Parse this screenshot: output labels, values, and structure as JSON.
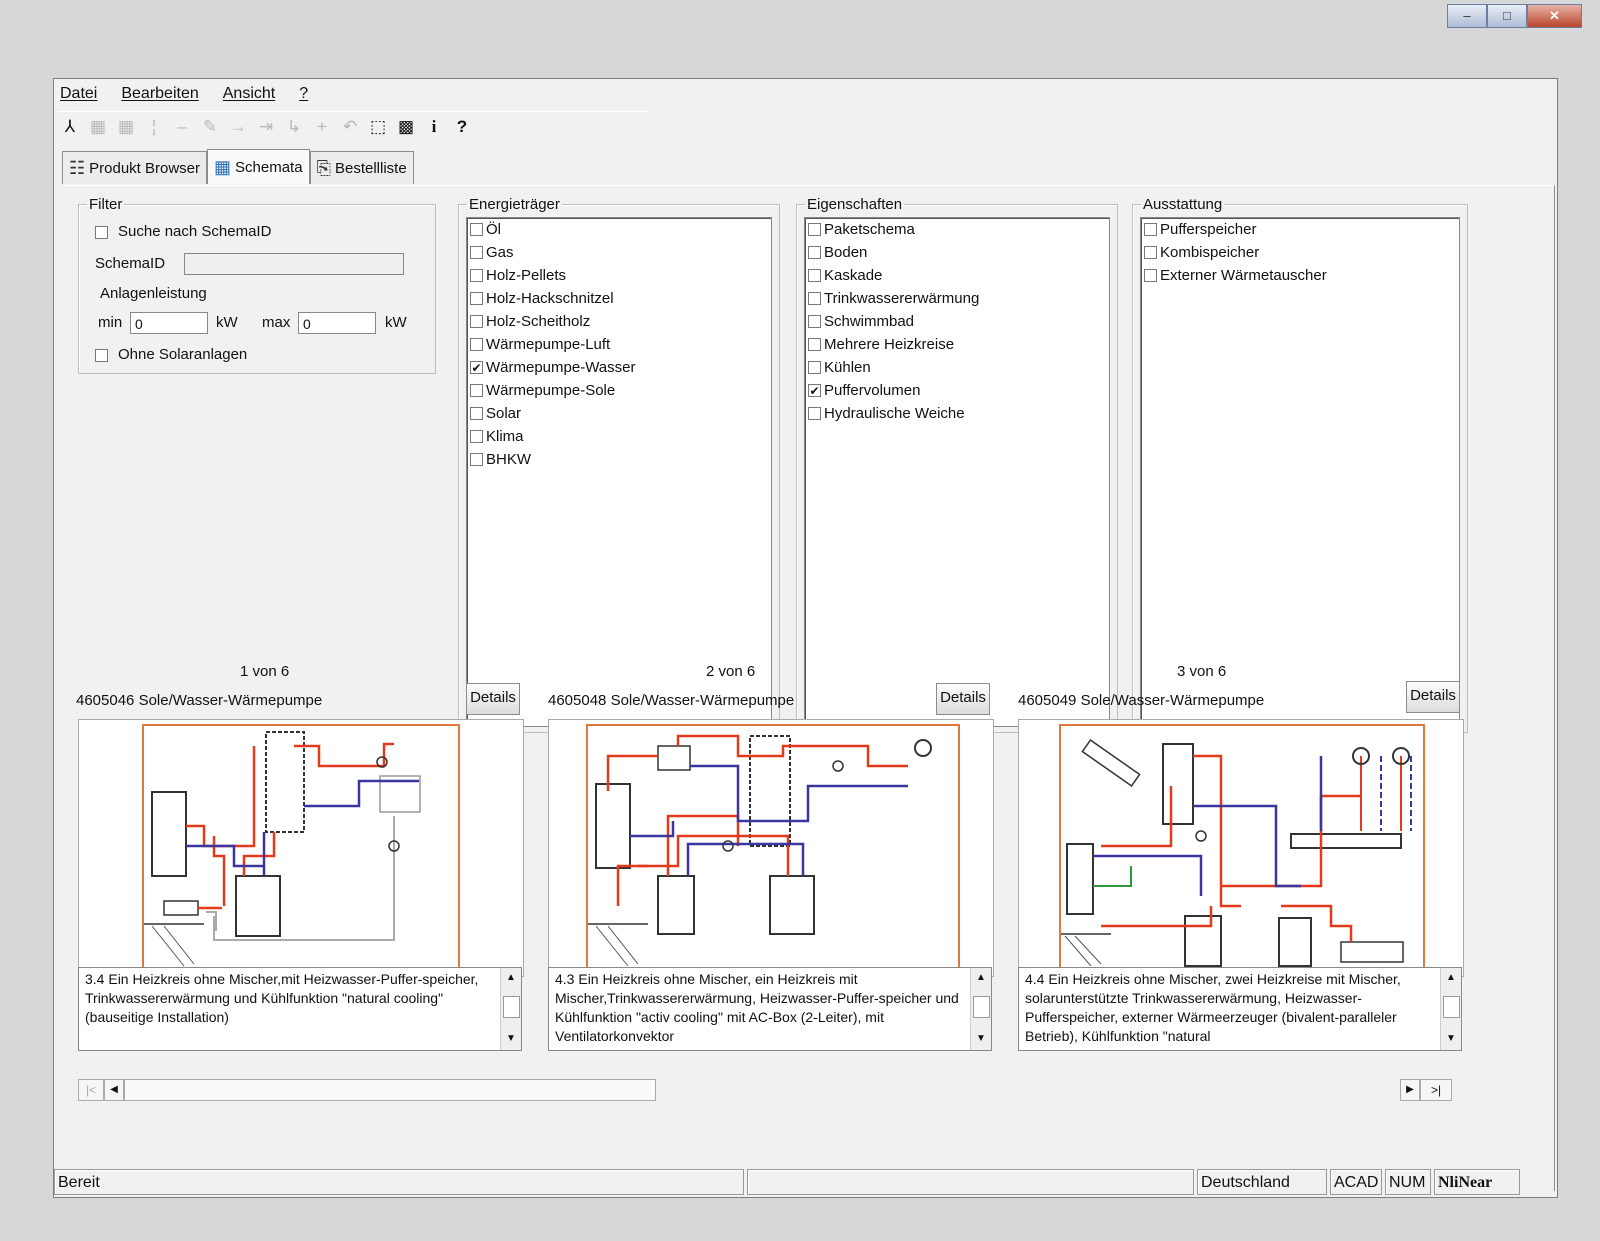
{
  "window_controls": {
    "minimize": "–",
    "maximize": "□",
    "close": "✕"
  },
  "menu": [
    "Datei",
    "Bearbeiten",
    "Ansicht",
    "?"
  ],
  "toolbar_icons": [
    "fork-icon",
    "edit-icon",
    "edit-icon",
    "separator-icon",
    "line-icon",
    "pencil-icon",
    "arrow-icon",
    "arrow-icon",
    "arrow-icon",
    "plus-icon",
    "undo-icon",
    "pointer-icon",
    "grid-icon",
    "info-icon",
    "help-icon"
  ],
  "tabs": [
    {
      "label": "Produkt Browser",
      "icon": "tree-icon"
    },
    {
      "label": "Schemata",
      "icon": "schema-icon"
    },
    {
      "label": "Bestellliste",
      "icon": "order-icon"
    }
  ],
  "filter": {
    "legend": "Filter",
    "search_label": "Suche nach SchemaID",
    "schema_id_label": "SchemaID",
    "schema_id_value": "",
    "power_label": "Anlagenleistung",
    "min_label": "min",
    "min_value": "0",
    "max_label": "max",
    "max_value": "0",
    "unit": "kW",
    "solar_label": "Ohne Solaranlagen"
  },
  "energietraeger": {
    "legend": "Energieträger",
    "items": [
      {
        "label": "Öl",
        "checked": false
      },
      {
        "label": "Gas",
        "checked": false
      },
      {
        "label": "Holz-Pellets",
        "checked": false
      },
      {
        "label": "Holz-Hackschnitzel",
        "checked": false
      },
      {
        "label": "Holz-Scheitholz",
        "checked": false
      },
      {
        "label": "Wärmepumpe-Luft",
        "checked": false
      },
      {
        "label": "Wärmepumpe-Wasser",
        "checked": true
      },
      {
        "label": "Wärmepumpe-Sole",
        "checked": false
      },
      {
        "label": "Solar",
        "checked": false
      },
      {
        "label": "Klima",
        "checked": false
      },
      {
        "label": "BHKW",
        "checked": false
      }
    ]
  },
  "eigenschaften": {
    "legend": "Eigenschaften",
    "items": [
      {
        "label": "Paketschema",
        "checked": false
      },
      {
        "label": "Boden",
        "checked": false
      },
      {
        "label": "Kaskade",
        "checked": false
      },
      {
        "label": "Trinkwassererwärmung",
        "checked": false
      },
      {
        "label": "Schwimmbad",
        "checked": false
      },
      {
        "label": "Mehrere Heizkreise",
        "checked": false
      },
      {
        "label": "Kühlen",
        "checked": false
      },
      {
        "label": "Puffervolumen",
        "checked": true
      },
      {
        "label": "Hydraulische Weiche",
        "checked": false
      }
    ]
  },
  "ausstattung": {
    "legend": "Ausstattung",
    "items": [
      {
        "label": "Pufferspeicher",
        "checked": false
      },
      {
        "label": "Kombispeicher",
        "checked": false
      },
      {
        "label": "Externer Wärmetauscher",
        "checked": false
      }
    ]
  },
  "results": [
    {
      "counter": "1 von 6",
      "title": "4605046 Sole/Wasser-Wärmepumpe",
      "details": "Details",
      "desc": "3.4 Ein Heizkreis ohne Mischer,mit Heizwasser-Puffer-speicher, Trinkwassererwärmung und Kühlfunktion \"natural cooling\" (bauseitige Installation)"
    },
    {
      "counter": "2 von 6",
      "title": "4605048 Sole/Wasser-Wärmepumpe",
      "details": "Details",
      "desc": "4.3 Ein Heizkreis ohne Mischer, ein Heizkreis mit Mischer,Trinkwassererwärmung, Heizwasser-Puffer-speicher und Kühlfunktion \"activ cooling\" mit AC-Box (2-Leiter), mit Ventilatorkonvektor"
    },
    {
      "counter": "3 von 6",
      "title": "4605049 Sole/Wasser-Wärmepumpe",
      "details": "Details",
      "desc": "4.4 Ein Heizkreis ohne Mischer, zwei Heizkreise mit Mischer, solarunterstützte Trinkwassererwärmung, Heizwasser-Pufferspeicher, externer Wärmeerzeuger (bivalent-paralleler Betrieb), Kühlfunktion \"natural"
    }
  ],
  "scroll": {
    "first": "|<",
    "prev": "◀",
    "next": "▶",
    "last": ">|"
  },
  "status": {
    "ready": "Bereit",
    "country": "Deutschland",
    "acad": "ACAD",
    "num": "NUM",
    "brand": "NliNear"
  },
  "colors": {
    "red": "#e23a1a",
    "blue": "#3a36a0",
    "orange_frame": "#e07a3a",
    "window_bg": "#f1f1f0"
  }
}
